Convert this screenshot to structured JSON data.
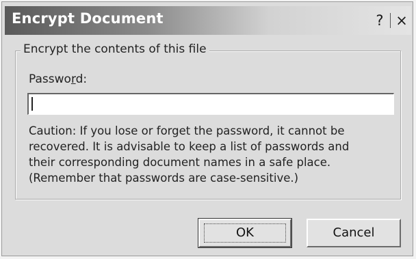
{
  "dialog": {
    "title": "Encrypt Document",
    "help_glyph": "?",
    "close_glyph": "×"
  },
  "group": {
    "legend": "Encrypt the contents of this file"
  },
  "password": {
    "label_pre": "Passwo",
    "label_accel": "r",
    "label_post": "d:",
    "value": "",
    "placeholder": ""
  },
  "caution": {
    "lines": [
      "Caution: If you lose or forget the password, it cannot be",
      "recovered. It is advisable to keep a list of passwords and",
      "their corresponding document names in a safe place.",
      "(Remember that passwords are case-sensitive.)"
    ]
  },
  "buttons": {
    "ok": "OK",
    "cancel": "Cancel"
  },
  "icons": {
    "help": "help-icon",
    "close": "close-icon"
  }
}
